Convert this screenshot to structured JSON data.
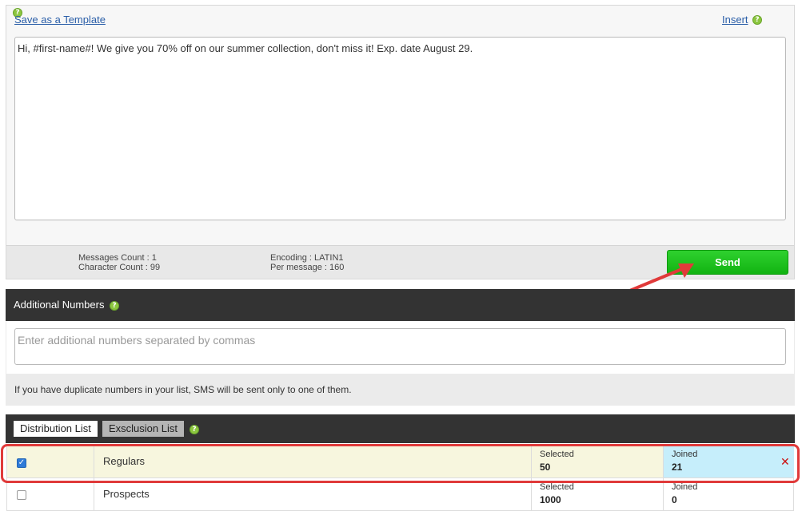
{
  "composer": {
    "save_template_label": "Save as a Template",
    "insert_label": "Insert",
    "message_text": "Hi, #first-name#! We give you 70% off on our summer collection, don't miss it! Exp. date August 29.",
    "messages_count": "Messages Count : 1",
    "character_count": "Character Count : 99",
    "encoding": "Encoding : LATIN1",
    "per_message": "Per message : 160",
    "send_label": "Send"
  },
  "additional_numbers": {
    "title": "Additional Numbers",
    "placeholder": "Enter additional numbers separated by commas",
    "duplicate_note": "If you have duplicate numbers in your list, SMS will be sent only to one of them."
  },
  "lists": {
    "tabs": [
      {
        "label": "Distribution List",
        "active": true
      },
      {
        "label": "Exsclusion List",
        "active": false
      }
    ],
    "rows": [
      {
        "name": "Regulars",
        "checked": true,
        "selected_label": "Selected",
        "selected_value": "50",
        "joined_label": "Joined",
        "joined_value": "21"
      },
      {
        "name": "Prospects",
        "checked": false,
        "selected_label": "Selected",
        "selected_value": "1000",
        "joined_label": "Joined",
        "joined_value": "0"
      }
    ]
  },
  "icons": {
    "help": "question-help-icon",
    "remove": "close-x-icon",
    "check": "checkmark-icon"
  },
  "colors": {
    "send_button": "#12b312",
    "dark_bar": "#333333",
    "link": "#2a5ea8",
    "highlight": "#e03a3a",
    "joined_cell": "#c6eefb",
    "row_highlight": "#f7f6de"
  }
}
